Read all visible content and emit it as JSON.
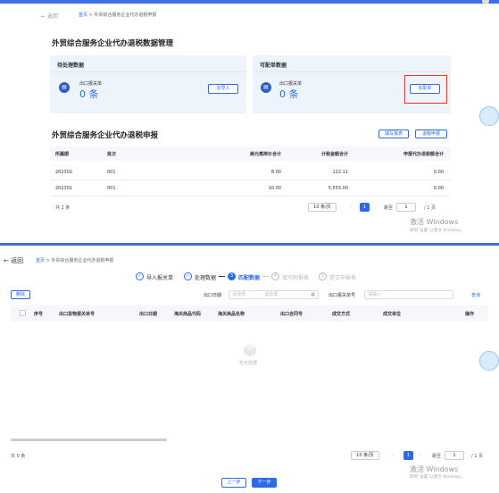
{
  "page1": {
    "back": "返回",
    "breadcrumb": {
      "home": "首页",
      "sep": ">",
      "current": "外贸综合服务企业代办退税申报"
    },
    "title": "外贸综合服务企业代办退税数据管理",
    "pending": {
      "title": "待处理数据",
      "label": "出口报关单",
      "count": "0 条",
      "button": "去导入"
    },
    "matchable": {
      "title": "可配单数据",
      "label": "出口报关单",
      "count": "0 条",
      "button": "去配单"
    },
    "section_title": "外贸综合服务企业代办退税申报",
    "actions": {
      "fill_form": "填写报表",
      "declare": "退税申报"
    },
    "table": {
      "headers": [
        "所属期",
        "批次",
        "美元离岸价合计",
        "计税金额合计",
        "申报代办退税额合计"
      ],
      "rows": [
        [
          "202302",
          "001",
          "8.00",
          "122.11",
          "0.00"
        ],
        [
          "202301",
          "001",
          "10.00",
          "5,555.00",
          "0.00"
        ]
      ]
    },
    "total": "共 2 条",
    "pagination": {
      "page_size": "10 条/页",
      "current": "1",
      "goto_label": "跳至",
      "goto_value": "1",
      "pages": "/ 1 页"
    },
    "watermark": {
      "line1": "激活 Windows",
      "line2": "转到\"设置\"以激活 Windows。"
    }
  },
  "page2": {
    "back": "返回",
    "breadcrumb": {
      "home": "首页",
      "sep": ">",
      "current": "外贸综合服务企业代办退税申报"
    },
    "steps": [
      {
        "icon": "✓",
        "label": "导入报关单"
      },
      {
        "icon": "✓",
        "label": "处理数据"
      },
      {
        "icon": "3",
        "label": "匹配数据"
      },
      {
        "icon": "4",
        "label": "填写附报表"
      },
      {
        "icon": "5",
        "label": "提交申报表"
      }
    ],
    "delete_button": "删除",
    "filter": {
      "date_label": "出口日期",
      "start_placeholder": "请选择",
      "sep": "-",
      "end_placeholder": "请选择",
      "decl_label": "出口报关单号",
      "decl_placeholder": "请输入",
      "query": "查询"
    },
    "table": {
      "headers": [
        "序号",
        "出口货物报关单号",
        "出口日期",
        "海关商品代码",
        "海关商品名称",
        "出口合同号",
        "成交方式",
        "成交单位",
        "操作"
      ]
    },
    "empty_text": "暂无数据",
    "total": "共 0 条",
    "pagination": {
      "page_size": "10 条/页",
      "current": "1",
      "goto_label": "跳至",
      "goto_value": "1",
      "pages": "/ 1 页"
    },
    "watermark": {
      "line1": "激活 Windows",
      "line2": "转到\"设置\"以激活 Windows。"
    },
    "prev_button": "上一步",
    "next_button": "下一步"
  },
  "colors": {
    "accent": "#2d6be4",
    "highlight": "#e5322d"
  }
}
